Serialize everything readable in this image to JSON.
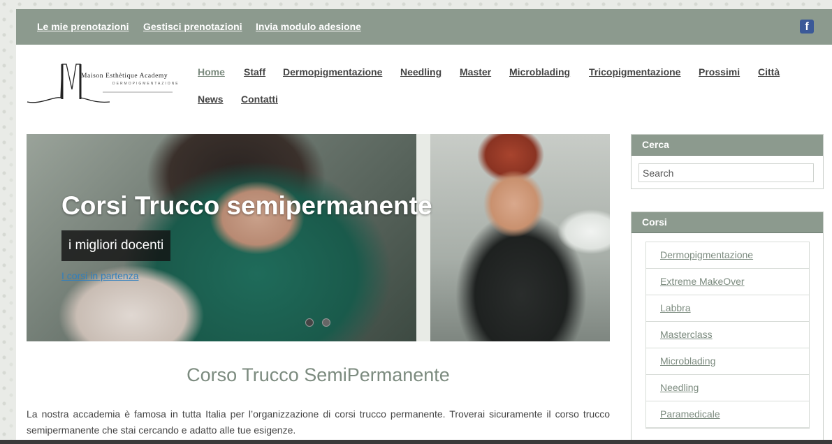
{
  "topbar": {
    "links": [
      "Le mie prenotazioni",
      "Gestisci prenotazioni",
      "Invia modulo adesione"
    ],
    "facebook_icon": "facebook-icon"
  },
  "logo": {
    "name": "Maison Esthètique Academy",
    "tagline": "DERMOPIGMENTAZIONE"
  },
  "nav": {
    "items": [
      "Home",
      "Staff",
      "Dermopigmentazione",
      "Needling",
      "Master",
      "Microblading",
      "Tricopigmentazione",
      "Prossimi",
      "Città",
      "News",
      "Contatti"
    ],
    "active": "Home"
  },
  "slider": {
    "title": "Corsi Trucco semipermanente",
    "subtitle": "i migliori docenti",
    "link": "I corsi in partenza",
    "dots": 2
  },
  "content": {
    "title": "Corso Trucco SemiPermanente",
    "text": "La nostra accademia è famosa in tutta Italia per l’organizzazione di corsi trucco permanente. Troverai sicuramente il corso trucco semipermanente che stai cercando e adatto alle tue esigenze."
  },
  "sidebar": {
    "search": {
      "title": "Cerca",
      "placeholder": "Search"
    },
    "courses": {
      "title": "Corsi",
      "items": [
        "Dermopigmentazione",
        "Extreme MakeOver",
        "Labbra",
        "Masterclass",
        "Microblading",
        "Needling",
        "Paramedicale"
      ]
    }
  },
  "colors": {
    "accent": "#8c9a8e",
    "link_green": "#7c8b7f",
    "link_blue": "#2f7fbf"
  }
}
